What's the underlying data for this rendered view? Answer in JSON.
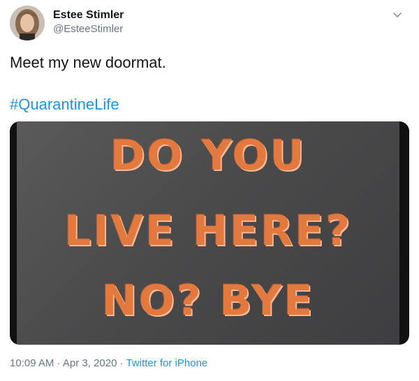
{
  "author": {
    "display_name": "Estee Stimler",
    "handle": "@EsteeStimler"
  },
  "tweet": {
    "text": "Meet my new doormat.",
    "hashtag": "#QuarantineLife"
  },
  "media": {
    "line1": "DO YOU",
    "line2": "LIVE HERE?",
    "line3": "NO? BYE"
  },
  "meta": {
    "time": "10:09 AM",
    "sep1": " · ",
    "date": "Apr 3, 2020",
    "sep2": " · ",
    "source": "Twitter for iPhone"
  },
  "colors": {
    "link": "#1b95e0",
    "secondary_text": "#657786",
    "mat_text": "#e2793f"
  },
  "icons": {
    "caret": "chevron-down-icon"
  }
}
